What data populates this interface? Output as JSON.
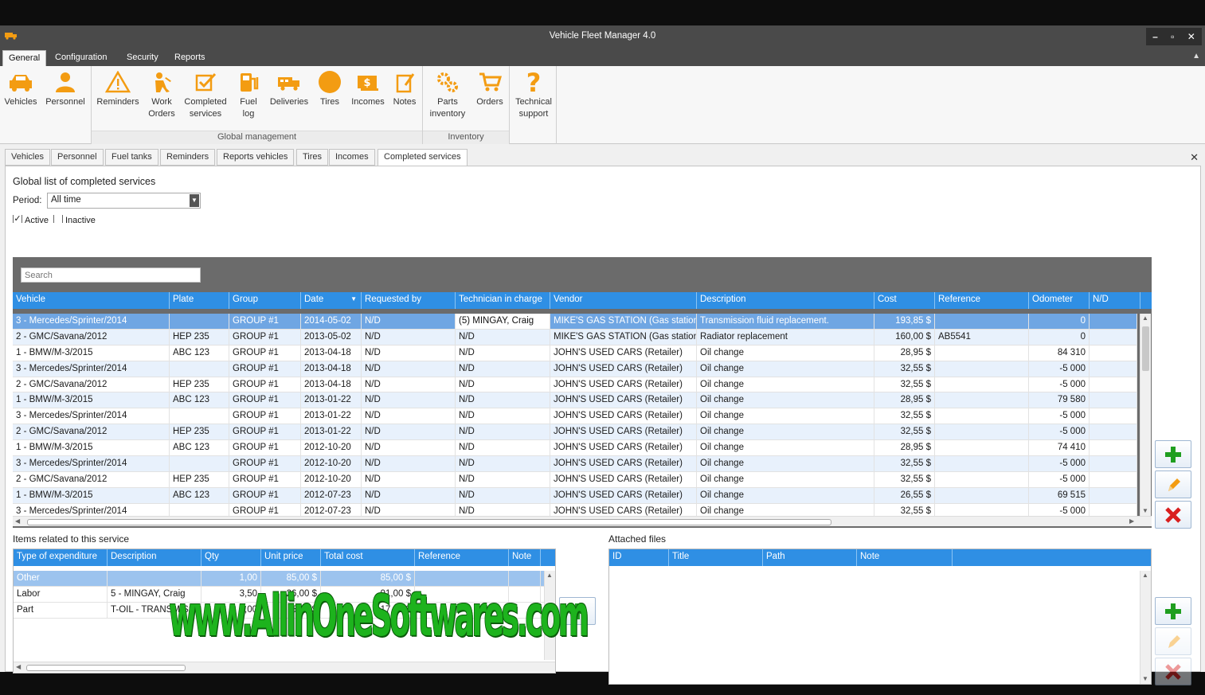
{
  "window": {
    "title": "Vehicle Fleet Manager 4.0",
    "minimize": "–",
    "maximize": "▫",
    "close": "✕"
  },
  "ribbon_tabs": [
    "General",
    "Configuration",
    "Security",
    "Reports"
  ],
  "ribbon": {
    "vehicles": "Vehicles",
    "personnel": "Personnel",
    "reminders": "Reminders",
    "work_orders_1": "Work",
    "work_orders_2": "Orders",
    "completed_1": "Completed",
    "completed_2": "services",
    "fuel_1": "Fuel",
    "fuel_2": "log",
    "deliveries": "Deliveries",
    "tires": "Tires",
    "incomes": "Incomes",
    "notes": "Notes",
    "parts_1": "Parts",
    "parts_2": "inventory",
    "orders": "Orders",
    "tech_1": "Technical",
    "tech_2": "support",
    "group_global": "Global management",
    "group_inventory": "Inventory"
  },
  "doc_tabs": [
    "Vehicles",
    "Personnel",
    "Fuel tanks",
    "Reminders",
    "Reports vehicles",
    "Tires",
    "Incomes",
    "Completed services"
  ],
  "doc_close": "✕",
  "main": {
    "title": "Global list of completed services",
    "period_label": "Period:",
    "period_value": "All time",
    "active_label": "Active",
    "inactive_label": "Inactive",
    "active_checked": true,
    "inactive_checked": false,
    "search_placeholder": "Search"
  },
  "services_table": {
    "columns": [
      "Vehicle",
      "Plate",
      "Group",
      "Date",
      "Requested by",
      "Technician in charge",
      "Vendor",
      "Description",
      "Cost",
      "Reference",
      "Odometer",
      "N/D"
    ],
    "rows": [
      [
        "3 - Mercedes/Sprinter/2014",
        "",
        "GROUP #1",
        "2014-05-02",
        "N/D",
        "(5) MINGAY, Craig",
        "MIKE'S GAS STATION (Gas station)",
        "Transmission fluid replacement.",
        "193,85 $",
        "",
        "0",
        ""
      ],
      [
        "2 - GMC/Savana/2012",
        "HEP 235",
        "GROUP #1",
        "2013-05-02",
        "N/D",
        "N/D",
        "MIKE'S GAS STATION (Gas station)",
        "Radiator replacement",
        "160,00 $",
        "AB5541",
        "0",
        ""
      ],
      [
        "1 - BMW/M-3/2015",
        "ABC 123",
        "GROUP #1",
        "2013-04-18",
        "N/D",
        "N/D",
        "JOHN'S USED CARS (Retailer)",
        "Oil change",
        "28,95 $",
        "",
        "84 310",
        ""
      ],
      [
        "3 - Mercedes/Sprinter/2014",
        "",
        "GROUP #1",
        "2013-04-18",
        "N/D",
        "N/D",
        "JOHN'S USED CARS (Retailer)",
        "Oil change",
        "32,55 $",
        "",
        "-5 000",
        ""
      ],
      [
        "2 - GMC/Savana/2012",
        "HEP 235",
        "GROUP #1",
        "2013-04-18",
        "N/D",
        "N/D",
        "JOHN'S USED CARS (Retailer)",
        "Oil change",
        "32,55 $",
        "",
        "-5 000",
        ""
      ],
      [
        "1 - BMW/M-3/2015",
        "ABC 123",
        "GROUP #1",
        "2013-01-22",
        "N/D",
        "N/D",
        "JOHN'S USED CARS (Retailer)",
        "Oil change",
        "28,95 $",
        "",
        "79 580",
        ""
      ],
      [
        "3 - Mercedes/Sprinter/2014",
        "",
        "GROUP #1",
        "2013-01-22",
        "N/D",
        "N/D",
        "JOHN'S USED CARS (Retailer)",
        "Oil change",
        "32,55 $",
        "",
        "-5 000",
        ""
      ],
      [
        "2 - GMC/Savana/2012",
        "HEP 235",
        "GROUP #1",
        "2013-01-22",
        "N/D",
        "N/D",
        "JOHN'S USED CARS (Retailer)",
        "Oil change",
        "32,55 $",
        "",
        "-5 000",
        ""
      ],
      [
        "1 - BMW/M-3/2015",
        "ABC 123",
        "GROUP #1",
        "2012-10-20",
        "N/D",
        "N/D",
        "JOHN'S USED CARS (Retailer)",
        "Oil change",
        "28,95 $",
        "",
        "74 410",
        ""
      ],
      [
        "3 - Mercedes/Sprinter/2014",
        "",
        "GROUP #1",
        "2012-10-20",
        "N/D",
        "N/D",
        "JOHN'S USED CARS (Retailer)",
        "Oil change",
        "32,55 $",
        "",
        "-5 000",
        ""
      ],
      [
        "2 - GMC/Savana/2012",
        "HEP 235",
        "GROUP #1",
        "2012-10-20",
        "N/D",
        "N/D",
        "JOHN'S USED CARS (Retailer)",
        "Oil change",
        "32,55 $",
        "",
        "-5 000",
        ""
      ],
      [
        "1 - BMW/M-3/2015",
        "ABC 123",
        "GROUP #1",
        "2012-07-23",
        "N/D",
        "N/D",
        "JOHN'S USED CARS (Retailer)",
        "Oil change",
        "26,55 $",
        "",
        "69 515",
        ""
      ],
      [
        "3 - Mercedes/Sprinter/2014",
        "",
        "GROUP #1",
        "2012-07-23",
        "N/D",
        "N/D",
        "JOHN'S USED CARS (Retailer)",
        "Oil change",
        "32,55 $",
        "",
        "-5 000",
        ""
      ]
    ]
  },
  "items": {
    "title": "Items related to this service",
    "columns": [
      "Type of expenditure",
      "Description",
      "Qty",
      "Unit price",
      "Total cost",
      "Reference",
      "Note"
    ],
    "rows": [
      [
        "Other",
        "",
        "1,00",
        "85,00 $",
        "85,00 $",
        "",
        ""
      ],
      [
        "Labor",
        "5 - MINGAY, Craig",
        "3,50",
        "26,00 $",
        "91,00 $",
        "",
        ""
      ],
      [
        "Part",
        "T-OIL - TRANSMISSI...",
        "3,00",
        "5,95 $",
        "17,85 $",
        "",
        ""
      ]
    ]
  },
  "files": {
    "title": "Attached files",
    "columns": [
      "ID",
      "Title",
      "Path",
      "Note"
    ]
  },
  "watermark": "www.AllinOneSoftwares.com",
  "colors": {
    "accent": "#2f8fe4",
    "selected_row": "#6fa6e3",
    "ribbon_icon": "#f39c12",
    "add_green": "#1f9e1f",
    "delete_red": "#d91f1f"
  }
}
